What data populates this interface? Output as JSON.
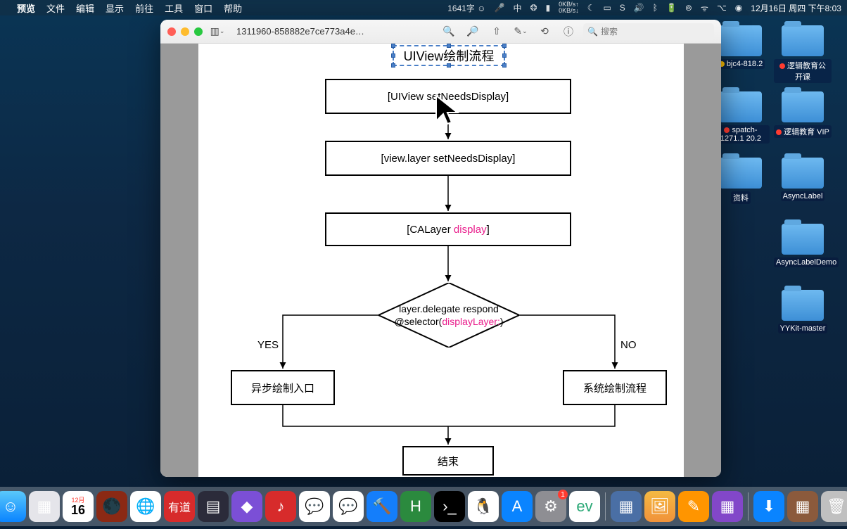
{
  "menubar": {
    "app": "预览",
    "items": [
      "文件",
      "编辑",
      "显示",
      "前往",
      "工具",
      "窗口",
      "帮助"
    ],
    "status": {
      "wordcount": "1641字",
      "ime": "中",
      "net_up": "0KB/s",
      "net_down": "0KB/s",
      "date": "12月16日 周四 下午8:03"
    }
  },
  "window": {
    "title": "1311960-858882e7ce773a4e…",
    "search_placeholder": "搜索"
  },
  "flowchart": {
    "title": "UIView绘制流程",
    "box1": "[UIView setNeedsDisplay]",
    "box2": "[view.layer setNeedsDisplay]",
    "box3_pre": "[CALayer ",
    "box3_pink": "display",
    "box3_post": "]",
    "decision_l1": "layer.delegate respond",
    "decision_l2a": "@selector(",
    "decision_l2b": "displayLayer:",
    "decision_l2c": ")",
    "yes": "YES",
    "no": "NO",
    "left_box": "异步绘制入口",
    "right_box": "系统绘制流程",
    "end": "结束"
  },
  "desktop": {
    "icons": [
      {
        "label": "bjc4-818.2",
        "color": "#ffbf00"
      },
      {
        "label": "逻辑教育公开课",
        "color": "#ff3b30"
      },
      {
        "label": "spatch-1271.1 20.2",
        "color": "#ff3b30"
      },
      {
        "label": "逻辑教育 VIP",
        "color": "#ff3b30"
      },
      {
        "label": "资料",
        "color": null
      },
      {
        "label": "AsyncLabel",
        "color": null
      },
      {
        "label": "AsyncLabelDemo",
        "color": null
      },
      {
        "label": "YYKit-master",
        "color": null
      }
    ]
  },
  "dock": {
    "apps": [
      "finder",
      "launchpad",
      "calendar",
      "preview-icon",
      "chrome",
      "youdao",
      "vscode",
      "figma",
      "netease",
      "messages",
      "wechat",
      "xcode",
      "hbuilder",
      "terminal",
      "qq",
      "appstore",
      "settings",
      "evernote",
      "omni",
      "safari",
      "photos",
      "pages",
      "numbers",
      "screenshot",
      "preview2",
      "downloads",
      "splitmgr",
      "trash"
    ],
    "badge": "1",
    "calendar_day": "16",
    "calendar_month": "12月"
  }
}
